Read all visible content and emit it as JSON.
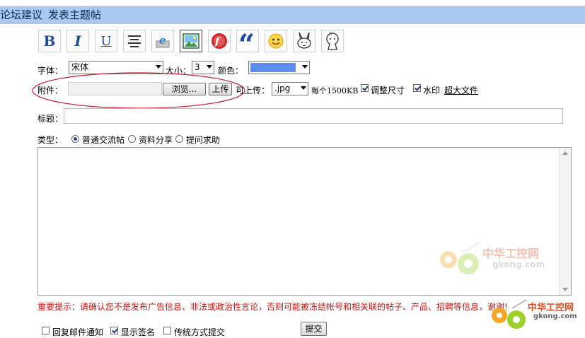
{
  "header": {
    "breadcrumb": "论坛建议",
    "title": "发表主题帖"
  },
  "toolbar": {
    "items": [
      {
        "name": "bold",
        "glyph": "B"
      },
      {
        "name": "italic",
        "glyph": "I"
      },
      {
        "name": "underline",
        "glyph": "U"
      }
    ]
  },
  "font_row": {
    "font_label": "字体：",
    "font_value": "宋体",
    "size_label": "大小：",
    "size_value": "3",
    "color_label": "颜色：",
    "color_value": "#5b8df0"
  },
  "attach_row": {
    "label": "附件：",
    "file_value": "",
    "browse_label": "浏览...",
    "upload_label": "上传",
    "allowed_label": "可上传：",
    "ext_value": ".jpg",
    "limit_label": "每个1500KB",
    "resize_label": "调整尺寸",
    "watermark_label": "水印",
    "bigfile_link": "超大文件"
  },
  "title_row": {
    "label": "标题：",
    "value": ""
  },
  "type_row": {
    "label": "类型：",
    "options": [
      "普通交流帖",
      "资料分享",
      "提问求助"
    ],
    "selected": 0
  },
  "notice": "重要提示：请确认您不是发布广告信息、非法或政治性言论，否则可能被冻结帐号和相关联的帖子、产品、招聘等信息，谢谢!",
  "footer": {
    "reply_email_label": "回复邮件通知",
    "reply_email_checked": false,
    "show_sig_label": "显示签名",
    "show_sig_checked": true,
    "traditional_label": "传统方式提交",
    "traditional_checked": false,
    "submit_label": "提交"
  },
  "watermark": {
    "cn": "中华工控网",
    "en": "gkong.com"
  }
}
